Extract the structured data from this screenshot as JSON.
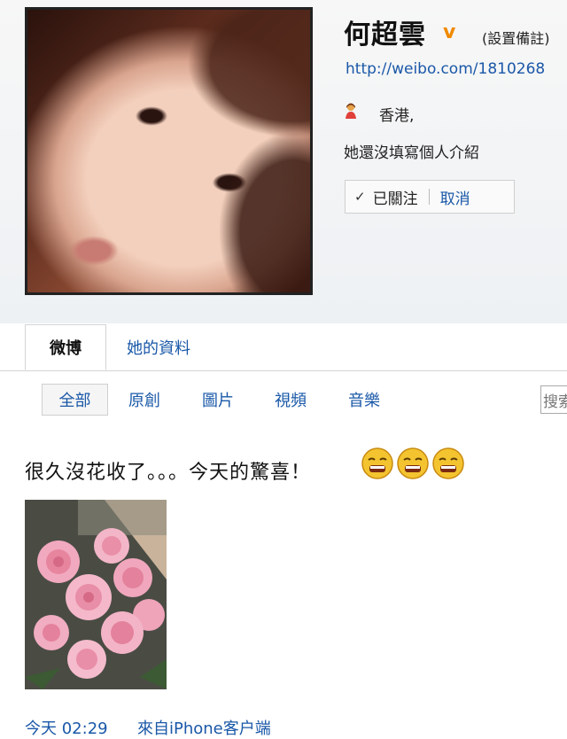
{
  "profile": {
    "name": "何超雲",
    "verified_mark": "v",
    "remark_link": "(設置備註)",
    "url": "http://weibo.com/1810268",
    "location": "香港,",
    "intro": "她還沒填寫個人介紹",
    "follow_check": "✓",
    "follow_status": "已關注",
    "cancel_label": "取消",
    "location_icon": "person-location-icon"
  },
  "tabs": [
    {
      "label": "微博",
      "active": true
    },
    {
      "label": "她的資料",
      "active": false
    }
  ],
  "filters": [
    {
      "label": "全部",
      "active": true
    },
    {
      "label": "原創",
      "active": false
    },
    {
      "label": "圖片",
      "active": false
    },
    {
      "label": "視頻",
      "active": false
    },
    {
      "label": "音樂",
      "active": false
    }
  ],
  "search": {
    "placeholder": "搜索"
  },
  "post": {
    "text": "很久沒花收了。。。今天的驚喜！",
    "emoticons": [
      "crying-face-icon",
      "crying-face-icon",
      "crying-face-icon"
    ],
    "photo_subject": "pink-roses-image",
    "time": "今天 02:29",
    "source": "來自iPhone客户端"
  },
  "colors": {
    "link": "#1a58a8",
    "verified": "#f08a00"
  }
}
